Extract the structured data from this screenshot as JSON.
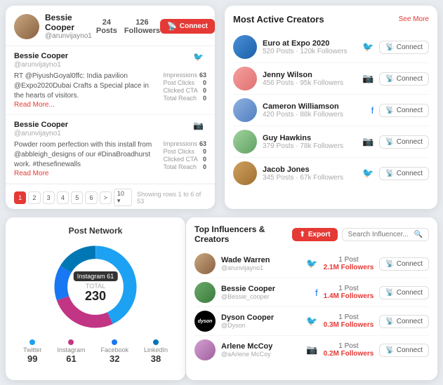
{
  "posts_card": {
    "user": {
      "name": "Bessie Cooper",
      "handle": "@arunvijayno1",
      "posts": "24 Posts",
      "followers": "126 Followers",
      "connect_label": "Connect"
    },
    "items": [
      {
        "author": "Bessie Cooper",
        "handle": "@arunvijayno1",
        "text": "RT @PiyushGoyal0ffc: India pavilion @Expo2020Dubai Crafts a Special place in the hearts of visitors.",
        "read_more": "Read More...",
        "social": "twitter",
        "stats": {
          "impressions": 63,
          "post_clicks": 0,
          "clicked_cta": 0,
          "total_reach": 0
        }
      },
      {
        "author": "Bessie Cooper",
        "handle": "@arunvijayno1",
        "text": "Powder room perfection with this install from @abbleigh_designs of our #DinaBroadhurst work. #thesefinewalls",
        "read_more": "Read More",
        "social": "instagram",
        "stats": {
          "impressions": 63,
          "post_clicks": 0,
          "clicked_cta": 0,
          "total_reach": 0
        }
      }
    ],
    "pagination": {
      "pages": [
        "1",
        "2",
        "3",
        "4",
        "5",
        "6",
        ">"
      ],
      "active": "1",
      "per_page": "10",
      "showing": "Showing rows 1 to 6 of 53"
    },
    "labels": {
      "impressions": "Impressions",
      "post_clicks": "Post Clicks",
      "clicked_cta": "Clicked CTA",
      "total_reach": "Total Reach"
    }
  },
  "creators_card": {
    "title": "Most Active Creators",
    "see_more": "See More",
    "connect_label": "Connect",
    "items": [
      {
        "name": "Euro at Expo 2020",
        "posts": "520 Posts",
        "followers": "120k Followers",
        "social": "twitter",
        "avatar_class": "ca-euro"
      },
      {
        "name": "Jenny Wilson",
        "posts": "456 Posts",
        "followers": "95k Followers",
        "social": "instagram",
        "avatar_class": "ca-jenny"
      },
      {
        "name": "Cameron Williamson",
        "posts": "420 Posts",
        "followers": "88k Followers",
        "social": "facebook",
        "avatar_class": "ca-cameron"
      },
      {
        "name": "Guy Hawkins",
        "posts": "379 Posts",
        "followers": "78k Followers",
        "social": "instagram",
        "avatar_class": "ca-guy"
      },
      {
        "name": "Jacob Jones",
        "posts": "345 Posts",
        "followers": "67k Followers",
        "social": "twitter",
        "avatar_class": "ca-jacob"
      }
    ]
  },
  "network_card": {
    "title": "Post Network",
    "total_label": "TOTAL",
    "total_value": "230",
    "instagram_label": "Instagram",
    "instagram_tag": "Instagram 61",
    "legend": [
      {
        "label": "Twitter",
        "value": "99"
      },
      {
        "label": "Instagram",
        "value": "61"
      },
      {
        "label": "Facebook",
        "value": "32"
      },
      {
        "label": "LinkedIn",
        "value": "38"
      }
    ],
    "donut": {
      "segments": [
        {
          "color": "#1da1f2",
          "percent": 43
        },
        {
          "color": "#c13584",
          "percent": 26.5
        },
        {
          "color": "#1877f2",
          "percent": 13.9
        },
        {
          "color": "#0077b5",
          "percent": 16.5
        }
      ]
    }
  },
  "influencers_card": {
    "title": "Top Influencers & Creators",
    "export_label": "Export",
    "search_placeholder": "Search Influencer...",
    "connect_label": "Connect",
    "items": [
      {
        "name": "Wade Warren",
        "handle": "@arunvijayno1",
        "posts": "1 Post",
        "followers": "2.1M Followers",
        "social": "twitter",
        "avatar_class": "ia-wade"
      },
      {
        "name": "Bessie Cooper",
        "handle": "@Bessie_cooper",
        "posts": "1 Post",
        "followers": "1.4M Followers",
        "social": "facebook",
        "avatar_class": "ia-bessie"
      },
      {
        "name": "Dyson Cooper",
        "handle": "@Dyson",
        "posts": "1 Post",
        "followers": "0.3M Followers",
        "social": "twitter",
        "avatar_class": "ia-dyson",
        "dyson_text": "dyson"
      },
      {
        "name": "Arlene McCoy",
        "handle": "@aArlene McCoy",
        "posts": "1 Post",
        "followers": "0.2M Followers",
        "social": "instagram",
        "avatar_class": "ia-arlene"
      }
    ]
  }
}
